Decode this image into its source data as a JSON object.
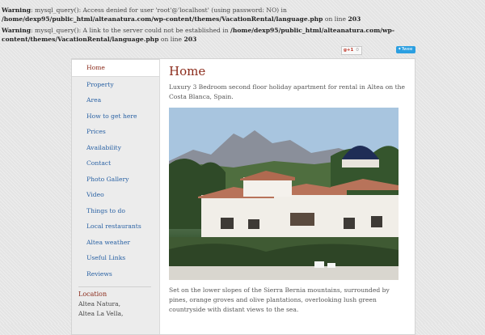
{
  "warnings": [
    {
      "label": "Warning",
      "message": ": mysql_query(): Access denied for user 'root'@'localhost' (using password: NO) in ",
      "path": "/home/dexp95/public_html/alteanatura.com/wp-content/themes/VacationRental/language.php",
      "line_text": " on line ",
      "line_no": "203"
    },
    {
      "label": "Warning",
      "message": ": mysql_query(): A link to the server could not be established in ",
      "path": "/home/dexp95/public_html/alteanatura.com/wp-content/themes/VacationRental/language.php",
      "line_text": " on line ",
      "line_no": "203"
    }
  ],
  "share": {
    "gplus_count": "0",
    "tweet_label": "Twee"
  },
  "nav": {
    "items": [
      {
        "label": "Home"
      },
      {
        "label": "Property"
      },
      {
        "label": "Area"
      },
      {
        "label": "How to get here"
      },
      {
        "label": "Prices"
      },
      {
        "label": "Availability"
      },
      {
        "label": "Contact"
      },
      {
        "label": "Photo Gallery"
      },
      {
        "label": "Video"
      },
      {
        "label": "Things to do"
      },
      {
        "label": "Local restaurants"
      },
      {
        "label": "Altea weather"
      },
      {
        "label": "Useful Links"
      },
      {
        "label": "Reviews"
      }
    ]
  },
  "location": {
    "title": "Location",
    "lines": [
      "Altea Natura,",
      "Altea La Vella,"
    ]
  },
  "page": {
    "title": "Home",
    "intro": "Luxury 3 Bedroom second floor holiday apartment for rental in Altea on the Costa Blanca, Spain.",
    "caption": "Set  on the lower slopes of the Sierra Bernia mountains, surrounded by pines, orange groves and olive plantations, overlooking lush green countryside with distant views to the sea."
  },
  "colors": {
    "accent": "#8b2b1b",
    "link": "#2a62a4",
    "tweet": "#2b9fe1"
  }
}
